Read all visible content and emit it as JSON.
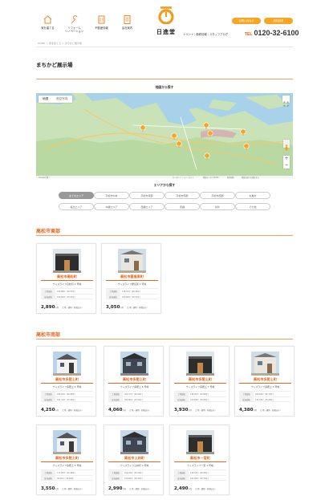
{
  "header": {
    "nav": [
      {
        "label": "家を建てる",
        "icon": "house-icon"
      },
      {
        "label": "リフォーム\nリノベーション",
        "icon": "wrench-icon"
      },
      {
        "label": "不動産情報",
        "icon": "building-icon"
      },
      {
        "label": "会社案内",
        "icon": "document-icon"
      }
    ],
    "logo_text": "日進堂",
    "btn_contact": "お問い合わせ",
    "btn_request": "資料請求",
    "links": "イベント｜新着情報｜スタッフブログ",
    "phone": "0120-32-6100",
    "tel_label": "TEL"
  },
  "breadcrumb": "HOME ＞ 家を建てる ＞ まちかど展示場",
  "page_title": "まちかど展示場",
  "map_section": {
    "title": "地図から探す",
    "tab_map": "地図",
    "tab_satellite": "航空写真",
    "footer": [
      "Googleで開く",
      "キーボード ショートカット",
      "地図データ ©2023",
      "利用規約",
      "地図の誤りを報告する"
    ]
  },
  "area_section": {
    "title": "エリアから探す",
    "buttons": [
      "全てのエリア",
      "高松市中央",
      "高松市東部",
      "高松市南部",
      "高松市西部",
      "丸亀市",
      "坂出エリア",
      "中讃エリア",
      "西讃エリア",
      "東讃",
      "県外",
      "その他"
    ]
  },
  "sections": [
    {
      "title": "高松市東部",
      "cards": [
        {
          "name": "高松市高松町",
          "plan": "ウィズライフ高松町 2 号地",
          "land_label": "土地面積",
          "land": "163.88m² (49.57坪)",
          "floor_label": "延床面積",
          "floor": "100.86m² (30.51坪)",
          "price": "2,890",
          "unit": "万円",
          "tax": "（土地・建物・外構込み）"
        },
        {
          "name": "高松市屋島東町",
          "plan": "ウィズライフ屋島東 3 号地",
          "land_label": "土地面積",
          "land": "218.01m² (65.94坪)",
          "floor_label": "延床面積",
          "floor": "100.86m² (30.51坪)",
          "price": "3,050",
          "unit": "万円",
          "tax": "（土地・建物・外構込み）"
        }
      ]
    },
    {
      "title": "高松市南部",
      "cards": [
        {
          "name": "高松市多肥上町",
          "plan": "ウィズライフ多肥上 9 号地",
          "land_label": "土地面積",
          "land": "200.62m² (60.68坪)",
          "floor_label": "延床面積",
          "floor": "104.34m² (31.56坪)",
          "price": "4,250",
          "unit": "万円",
          "tax": "（土地・建物・外構込み）"
        },
        {
          "name": "高松市多肥上町",
          "plan": "ウィズライフ多肥上 8 号地",
          "land_label": "土地面積",
          "land": "200.47m² (60.64坪)",
          "floor_label": "延床面積",
          "floor": "100.86m² (30.51坪)",
          "price": "4,060",
          "unit": "万円",
          "tax": "（土地・建物・外構込み）"
        },
        {
          "name": "高松市多肥上町",
          "plan": "ウィズライフ多肥上 7 号地",
          "land_label": "土地面積",
          "land": "198.00m² (59.89坪)",
          "floor_label": "延床面積",
          "floor": "100.86m² (30.51坪)",
          "price": "3,930",
          "unit": "万円",
          "tax": "（土地・建物・外構込み）"
        },
        {
          "name": "高松市多肥上町",
          "plan": "ウィズライフ多肥上 6 号地",
          "land_label": "土地面積",
          "land": "200.69m² (60.70坪)",
          "floor_label": "延床面積",
          "floor": "115.93m² (35.06坪)",
          "price": "4,380",
          "unit": "万円",
          "tax": "（土地・建物・外構込み）"
        },
        {
          "name": "高松市多肥上町",
          "plan": "ウィズライフ多肥上 5 号地",
          "land_label": "土地面積",
          "land": "172.85m² (52.28坪)",
          "floor_label": "延床面積",
          "floor": "96.05m² (29.05坪)",
          "price": "3,550",
          "unit": "万円",
          "tax": "（土地・建物・外構込み）"
        },
        {
          "name": "高松市上林町",
          "plan": "ウィズライフ上林町 3 号地",
          "land_label": "土地面積",
          "land": "166.03m² (50.22坪)",
          "floor_label": "延床面積",
          "floor": "100.86m² (30.51坪)",
          "price": "2,990",
          "unit": "万円",
          "tax": "（土地・建物・外構込み）"
        },
        {
          "name": "高松市一宮町",
          "plan": "ウィズライフ一宮 1 号地",
          "land_label": "土地面積",
          "land": "198.54m² (60.05坪)",
          "floor_label": "延床面積",
          "floor": "101.68m² (30.75坪)",
          "price": "2,490",
          "unit": "万円",
          "tax": "（土地・建物・外構込み）"
        }
      ]
    }
  ],
  "colors": {
    "accent": "#e8661c",
    "pill": "#f5a623",
    "map_sea": "#a8d2ea",
    "map_land": "#c9e2b8"
  }
}
